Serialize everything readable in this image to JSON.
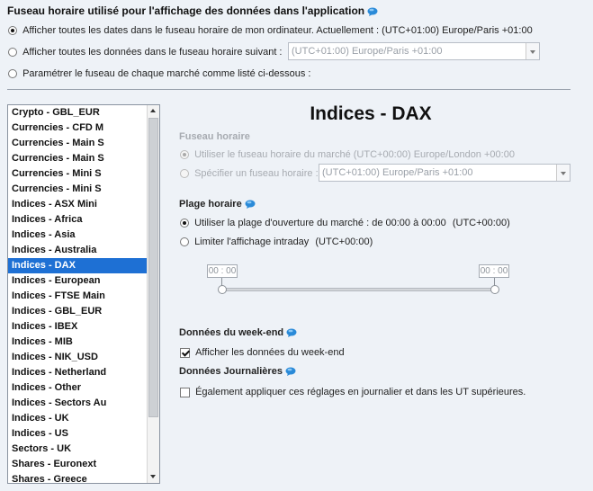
{
  "top": {
    "title": "Fuseau horaire utilisé pour l'affichage des données dans l'application",
    "option_device": "Afficher toutes les dates dans le fuseau horaire de mon ordinateur. Actuellement : (UTC+01:00) Europe/Paris +01:00",
    "option_following": "Afficher toutes les données dans le fuseau horaire suivant :",
    "option_following_select": "(UTC+01:00) Europe/Paris +01:00",
    "option_per_market": "Paramétrer le fuseau de chaque marché comme listé ci-dessous :"
  },
  "markets": {
    "items": [
      "Crypto - GBL_EUR",
      "Currencies - CFD M",
      "Currencies - Main S",
      "Currencies - Main S",
      "Currencies - Mini S",
      "Currencies - Mini S",
      "Indices - ASX Mini",
      "Indices - Africa",
      "Indices - Asia",
      "Indices - Australia",
      "Indices - DAX",
      "Indices - European",
      "Indices - FTSE Main",
      "Indices - GBL_EUR",
      "Indices - IBEX",
      "Indices - MIB",
      "Indices - NIK_USD",
      "Indices - Netherland",
      "Indices - Other",
      "Indices - Sectors Au",
      "Indices - UK",
      "Indices - US",
      "Sectors - UK",
      "Shares - Euronext",
      "Shares - Greece"
    ],
    "selected": "Indices - DAX"
  },
  "detail": {
    "title": "Indices - DAX",
    "timezone": {
      "label": "Fuseau horaire",
      "market_option": "Utiliser le fuseau horaire du marché (UTC+00:00) Europe/London +00:00",
      "custom_option": "Spécifier un fuseau horaire :",
      "custom_select": "(UTC+01:00) Europe/Paris +01:00"
    },
    "range": {
      "label": "Plage horaire",
      "opening_option": "Utiliser la plage d'ouverture du marché : de 00:00 à 00:00",
      "opening_utc": "(UTC+00:00)",
      "intraday_option": "Limiter l'affichage intraday",
      "intraday_utc": "(UTC+00:00)",
      "start_time": "00 : 00",
      "end_time": "00 : 00"
    },
    "weekend": {
      "label": "Données du week-end",
      "checkbox": "Afficher les données du week-end"
    },
    "daily": {
      "label": "Données Journalières",
      "checkbox": "Également appliquer ces réglages en journalier et dans les UT supérieures."
    }
  },
  "colors": {
    "background": "#eef2f7",
    "selection": "#1e70d4",
    "info_icon": "#2a8ad8"
  }
}
